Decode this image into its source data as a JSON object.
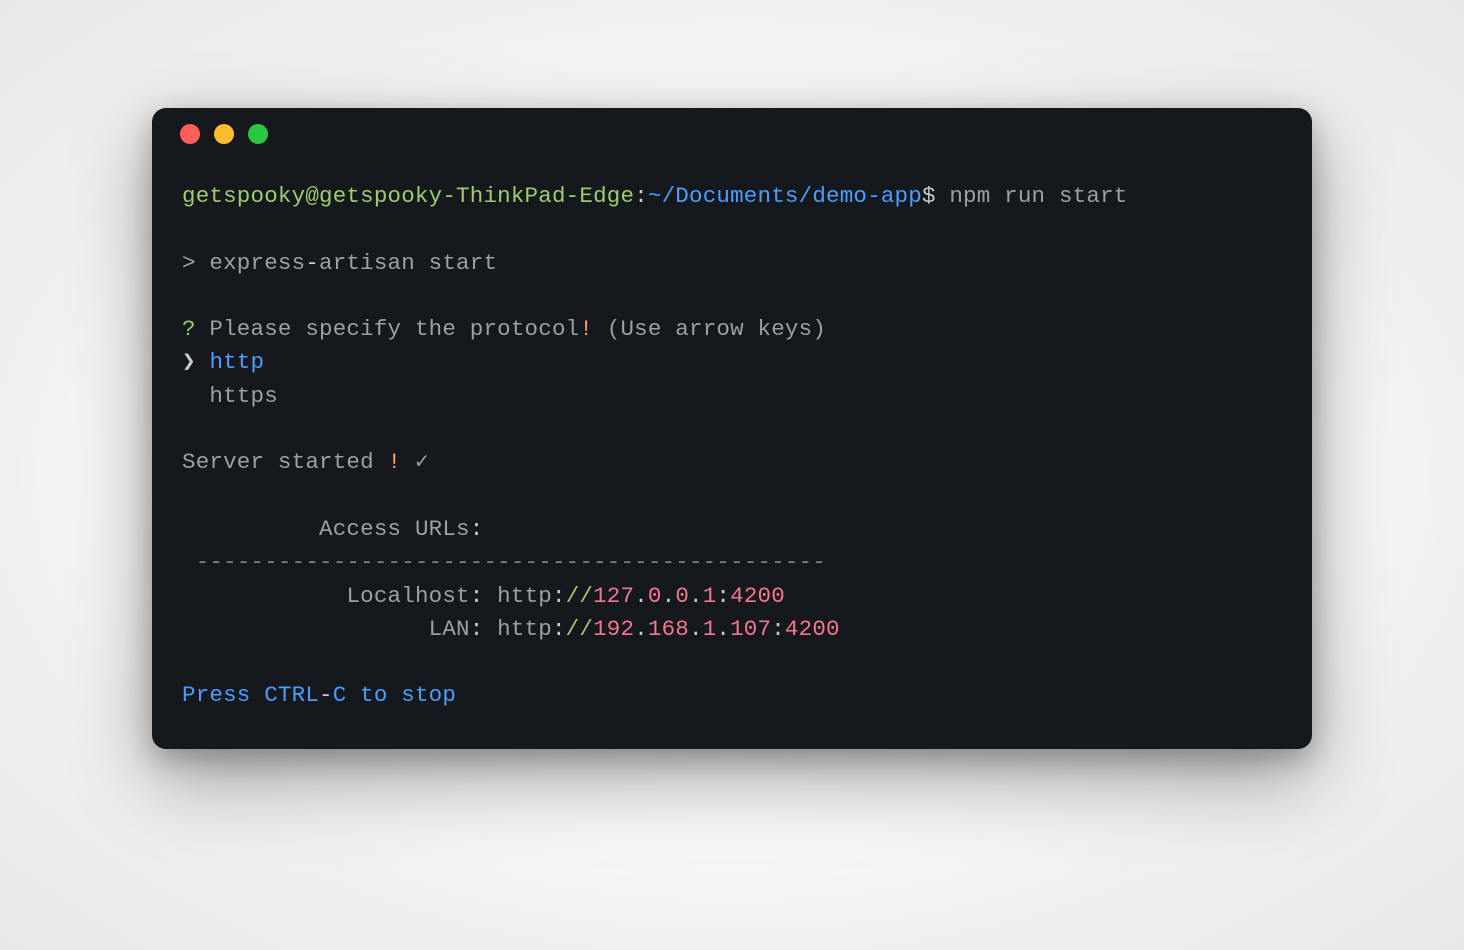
{
  "prompt": {
    "user_host": "getspooky@getspooky-ThinkPad-Edge",
    "colon": ":",
    "path": "~/Documents/demo-app",
    "dollar": "$ ",
    "command": "npm run start"
  },
  "script_line": {
    "prefix": "> ",
    "text1": "express",
    "dash": "-",
    "text2": "artisan start"
  },
  "question": {
    "mark": "? ",
    "text": "Please specify the protocol",
    "bang": "!",
    "hint": " (Use arrow keys)"
  },
  "options": {
    "pointer": "❯ ",
    "selected": "http",
    "indent": "  ",
    "other": "https"
  },
  "server": {
    "text": "Server started ",
    "bang": "!",
    "space_check": " ✓"
  },
  "access": {
    "header_indent": "          ",
    "header": "Access URLs",
    "header_colon": ":",
    "divider": " ----------------------------------------------"
  },
  "localhost": {
    "indent": "            ",
    "label": "Localhost",
    "colon": ":",
    "space": " ",
    "scheme": "http",
    "colon2": ":",
    "slashes": "//",
    "oct1": "127",
    "dot1": ".",
    "oct2": "0",
    "dot2": ".",
    "oct3": "0",
    "dot3": ".",
    "oct4": "1",
    "colon3": ":",
    "port": "4200"
  },
  "lan": {
    "indent": "                  ",
    "label": "LAN",
    "colon": ":",
    "space": " ",
    "scheme": "http",
    "colon2": ":",
    "slashes": "//",
    "oct1": "192",
    "dot1": ".",
    "oct2": "168",
    "dot2": ".",
    "oct3": "1",
    "dot3": ".",
    "oct4": "107",
    "colon3": ":",
    "port": "4200"
  },
  "footer": {
    "text1": "Press CTRL",
    "dash": "-",
    "text2": "C to stop"
  }
}
